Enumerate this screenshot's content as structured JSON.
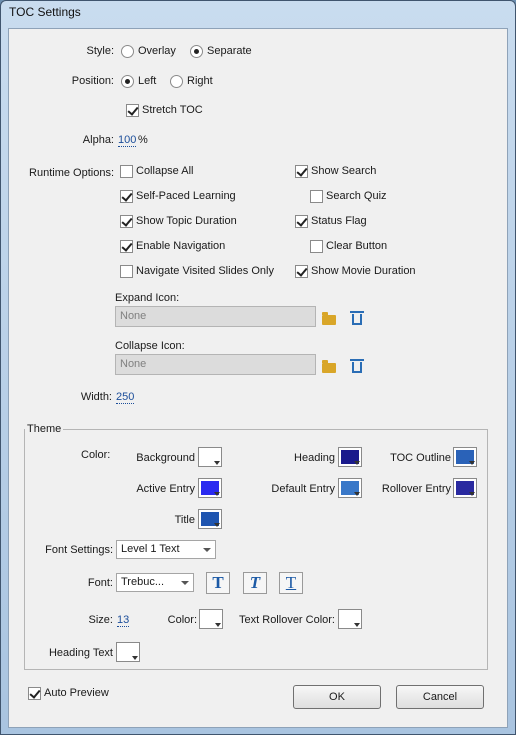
{
  "window": {
    "title": "TOC Settings"
  },
  "style": {
    "label": "Style:",
    "options": [
      "Overlay",
      "Separate"
    ],
    "selected": "Separate"
  },
  "position": {
    "label": "Position:",
    "options": [
      "Left",
      "Right"
    ],
    "selected": "Left"
  },
  "stretch_toc": {
    "label": "Stretch TOC",
    "checked": true
  },
  "alpha": {
    "label": "Alpha:",
    "value": "100",
    "unit": "%"
  },
  "runtime": {
    "label": "Runtime Options:",
    "left": [
      {
        "label": "Collapse All",
        "checked": false
      },
      {
        "label": "Self-Paced Learning",
        "checked": true
      },
      {
        "label": "Show Topic Duration",
        "checked": true
      },
      {
        "label": "Enable Navigation",
        "checked": true
      },
      {
        "label": "Navigate Visited Slides Only",
        "checked": false
      }
    ],
    "right": [
      {
        "label": "Show Search",
        "checked": true
      },
      {
        "label": "Search Quiz",
        "checked": false
      },
      {
        "label": "Status Flag",
        "checked": true
      },
      {
        "label": "Clear Button",
        "checked": false
      },
      {
        "label": "Show Movie Duration",
        "checked": true
      }
    ]
  },
  "expand_icon": {
    "label": "Expand Icon:",
    "value": "None"
  },
  "collapse_icon": {
    "label": "Collapse Icon:",
    "value": "None"
  },
  "width": {
    "label": "Width:",
    "value": "250"
  },
  "theme": {
    "label": "Theme",
    "color_label": "Color:",
    "swatches": {
      "background": {
        "label": "Background",
        "color": "#ffffff"
      },
      "heading": {
        "label": "Heading",
        "color": "#1a1a8c"
      },
      "toc_outline": {
        "label": "TOC Outline",
        "color": "#2a62b8"
      },
      "active_entry": {
        "label": "Active Entry",
        "color": "#2a2af0"
      },
      "default_entry": {
        "label": "Default Entry",
        "color": "#3a78c8"
      },
      "rollover_entry": {
        "label": "Rollover Entry",
        "color": "#2a2aa0"
      },
      "title": {
        "label": "Title",
        "color": "#1f55b0"
      }
    },
    "font_settings": {
      "label": "Font Settings:",
      "value": "Level 1 Text"
    },
    "font": {
      "label": "Font:",
      "value": "Trebuc...",
      "style_glyphs": [
        "T",
        "T",
        "T"
      ]
    },
    "size": {
      "label": "Size:",
      "value": "13"
    },
    "color": {
      "label": "Color:",
      "color": "#ffffff"
    },
    "text_rollover_color": {
      "label": "Text Rollover Color:",
      "color": "#ffffff"
    },
    "heading_text": {
      "label": "Heading Text",
      "color": "#ffffff"
    }
  },
  "auto_preview": {
    "label": "Auto Preview",
    "checked": true
  },
  "buttons": {
    "ok": "OK",
    "cancel": "Cancel"
  }
}
